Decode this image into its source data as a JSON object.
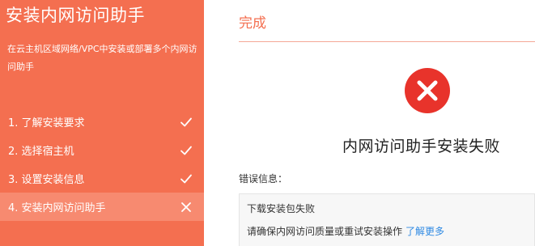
{
  "sidebar": {
    "title": "安装内网访问助手",
    "description": "在云主机区域网络/VPC中安装或部署多个内网访问助手",
    "steps": [
      {
        "label": "1. 了解安装要求",
        "status": "done",
        "icon": "check-icon"
      },
      {
        "label": "2. 选择宿主机",
        "status": "done",
        "icon": "check-icon"
      },
      {
        "label": "3. 设置安装信息",
        "status": "done",
        "icon": "check-icon"
      },
      {
        "label": "4. 安装内网访问助手",
        "status": "failed",
        "icon": "close-icon"
      }
    ]
  },
  "main": {
    "title": "完成",
    "result_icon": "error-circle-icon",
    "result_text": "内网访问助手安装失败",
    "error_label": "错误信息：",
    "error_line1": "下载安装包失败",
    "error_line2": "请确保内网访问质量或重试安装操作",
    "learn_more": "了解更多"
  },
  "colors": {
    "sidebar_bg": "#f46f50",
    "active_step_bg": "#f78a70",
    "accent": "#f46f50",
    "error_red": "#e8332b",
    "link": "#2f8ae3"
  }
}
